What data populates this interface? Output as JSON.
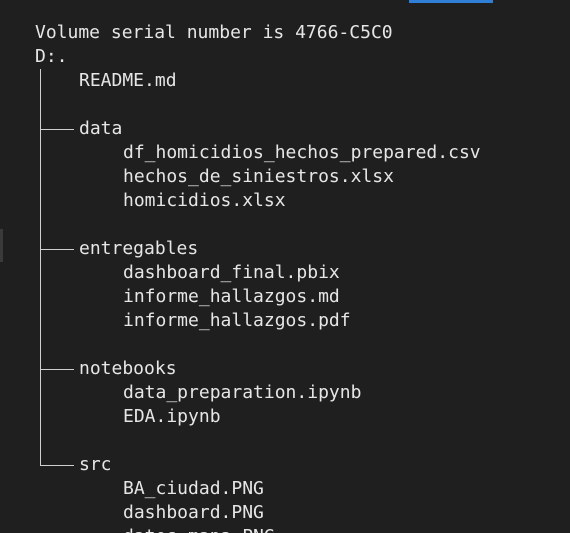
{
  "terminal": {
    "header_line": "Volume serial number is 4766-C5C0",
    "drive_line": "D:.",
    "root_files": [
      "README.md"
    ],
    "folders": [
      {
        "name": "data",
        "files": [
          "df_homicidios_hechos_prepared.csv",
          "hechos_de_siniestros.xlsx",
          "homicidios.xlsx"
        ]
      },
      {
        "name": "entregables",
        "files": [
          "dashboard_final.pbix",
          "informe_hallazgos.md",
          "informe_hallazgos.pdf"
        ]
      },
      {
        "name": "notebooks",
        "files": [
          "data_preparation.ipynb",
          "EDA.ipynb"
        ]
      },
      {
        "name": "src",
        "files": [
          "BA_ciudad.PNG",
          "dashboard.PNG",
          "datos_mapa.PNG"
        ]
      }
    ]
  }
}
